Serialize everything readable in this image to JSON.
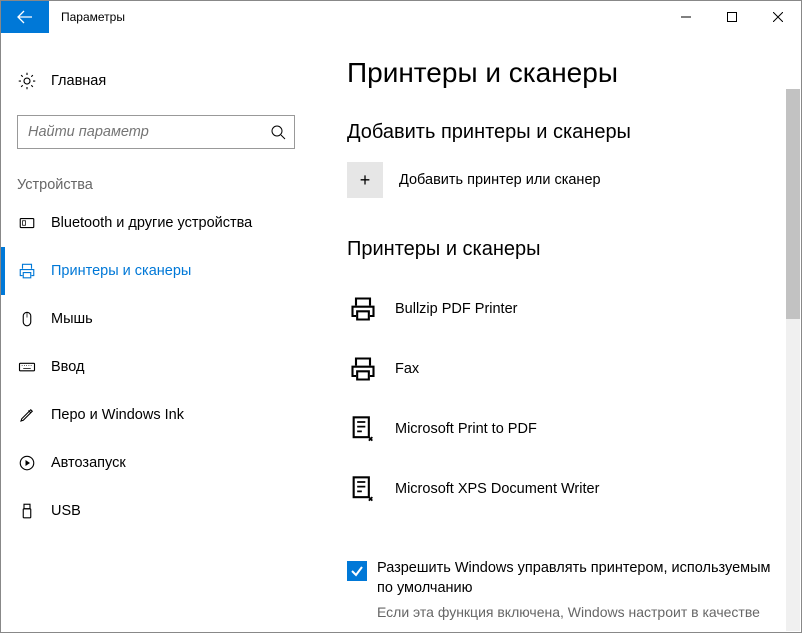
{
  "window": {
    "title": "Параметры"
  },
  "sidebar": {
    "home_label": "Главная",
    "search_placeholder": "Найти параметр",
    "category_label": "Устройства",
    "items": [
      {
        "label": "Bluetooth и другие устройства"
      },
      {
        "label": "Принтеры и сканеры"
      },
      {
        "label": "Мышь"
      },
      {
        "label": "Ввод"
      },
      {
        "label": "Перо и Windows Ink"
      },
      {
        "label": "Автозапуск"
      },
      {
        "label": "USB"
      }
    ]
  },
  "main": {
    "heading": "Принтеры и сканеры",
    "add_section_title": "Добавить принтеры и сканеры",
    "add_button_label": "Добавить принтер или сканер",
    "list_section_title": "Принтеры и сканеры",
    "printers": [
      {
        "name": "Bullzip PDF Printer"
      },
      {
        "name": "Fax"
      },
      {
        "name": "Microsoft Print to PDF"
      },
      {
        "name": "Microsoft XPS Document Writer"
      }
    ],
    "default_checkbox_label": "Разрешить Windows управлять принтером, используемым по умолчанию",
    "default_checkbox_desc": "Если эта функция включена, Windows настроит в качестве"
  }
}
